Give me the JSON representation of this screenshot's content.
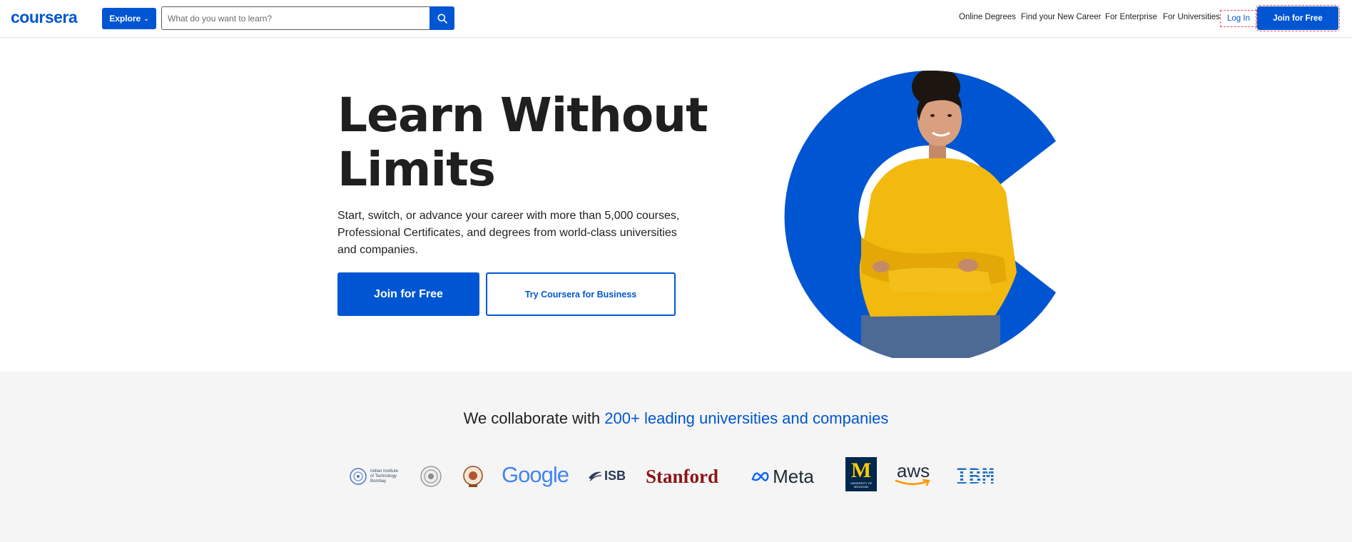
{
  "header": {
    "logo": "coursera",
    "explore_label": "Explore",
    "search_placeholder": "What do you want to learn?",
    "nav_links": [
      "Online Degrees",
      "Find your New Career",
      "For Enterprise",
      "For Universities"
    ],
    "login_label": "Log In",
    "join_label": "Join for Free"
  },
  "hero": {
    "title_line1": "Learn Without",
    "title_line2": "Limits",
    "subtitle": "Start, switch, or advance your career with more than 5,000 courses, Professional Certificates, and degrees from world-class universities and companies.",
    "join_label": "Join for Free",
    "business_label": "Try Coursera for Business"
  },
  "collab": {
    "title_prefix": "We collaborate with ",
    "title_accent": "200+ leading universities and companies",
    "partners": {
      "iitb_text": "Indian Institute of Technology Bombay",
      "google": "Google",
      "isb": "ISB",
      "stanford": "Stanford",
      "meta": "Meta",
      "michigan_letter": "M",
      "michigan_text": "UNIVERSITY OF MICHIGAN",
      "aws": "aws",
      "ibm": "IBM"
    }
  },
  "colors": {
    "brand_blue": "#0056d2",
    "stanford_red": "#8c1515",
    "sweater_yellow": "#f2b90f",
    "collab_bg": "#f5f5f5"
  }
}
